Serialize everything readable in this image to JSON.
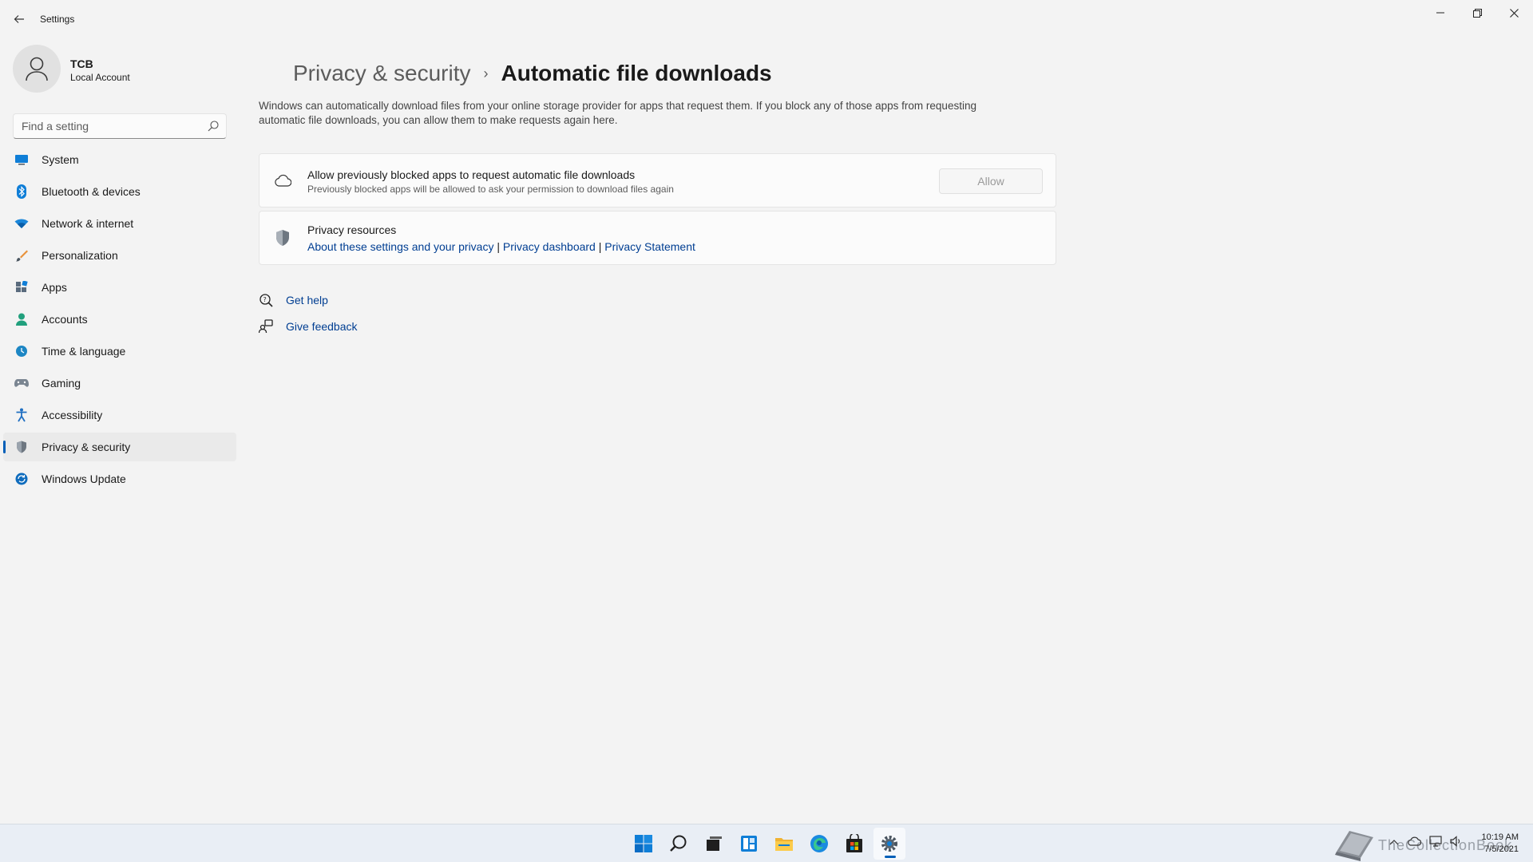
{
  "window": {
    "title": "Settings",
    "controls": {
      "minimize": "—",
      "maximize": "❐",
      "close": "✕"
    }
  },
  "profile": {
    "name": "TCB",
    "account_type": "Local Account"
  },
  "search": {
    "placeholder": "Find a setting"
  },
  "sidebar": {
    "items": [
      {
        "label": "System",
        "icon": "system-icon",
        "color": "#0078d4"
      },
      {
        "label": "Bluetooth & devices",
        "icon": "bluetooth-icon",
        "color": "#0078d4"
      },
      {
        "label": "Network & internet",
        "icon": "wifi-icon",
        "color": "#0078d4"
      },
      {
        "label": "Personalization",
        "icon": "brush-icon",
        "color": "#e8913a"
      },
      {
        "label": "Apps",
        "icon": "apps-icon",
        "color": "#5a6b7d"
      },
      {
        "label": "Accounts",
        "icon": "account-icon",
        "color": "#21a07d"
      },
      {
        "label": "Time & language",
        "icon": "globe-clock-icon",
        "color": "#1d86c4"
      },
      {
        "label": "Gaming",
        "icon": "gamepad-icon",
        "color": "#7a8591"
      },
      {
        "label": "Accessibility",
        "icon": "accessibility-icon",
        "color": "#1f6fc2"
      },
      {
        "label": "Privacy & security",
        "icon": "shield-icon",
        "color": "#6e7781",
        "active": true
      },
      {
        "label": "Windows Update",
        "icon": "update-icon",
        "color": "#0f6cbd"
      }
    ]
  },
  "breadcrumb": {
    "parent": "Privacy & security",
    "separator": "›",
    "current": "Automatic file downloads"
  },
  "description": "Windows can automatically download files from your online storage provider for apps that request them. If you block any of those apps from requesting automatic file downloads, you can allow them to make requests again here.",
  "allow_card": {
    "icon": "cloud-icon",
    "title": "Allow previously blocked apps to request automatic file downloads",
    "subtitle": "Previously blocked apps will be allowed to ask your permission to download files again",
    "button": "Allow",
    "button_enabled": false
  },
  "privacy_card": {
    "icon": "shield-icon",
    "title": "Privacy resources",
    "links": [
      "About these settings and your privacy",
      "Privacy dashboard",
      "Privacy Statement"
    ],
    "separator": "|"
  },
  "help": {
    "get_help": "Get help",
    "give_feedback": "Give feedback"
  },
  "taskbar": {
    "apps": [
      "start-icon",
      "search-icon",
      "task-view-icon",
      "widgets-icon",
      "file-explorer-icon",
      "edge-icon",
      "store-icon",
      "settings-icon"
    ],
    "active_app": "settings-icon",
    "watermark": "TheCollectionBook",
    "clock": {
      "time": "10:19 AM",
      "date": "7/5/2021"
    }
  }
}
